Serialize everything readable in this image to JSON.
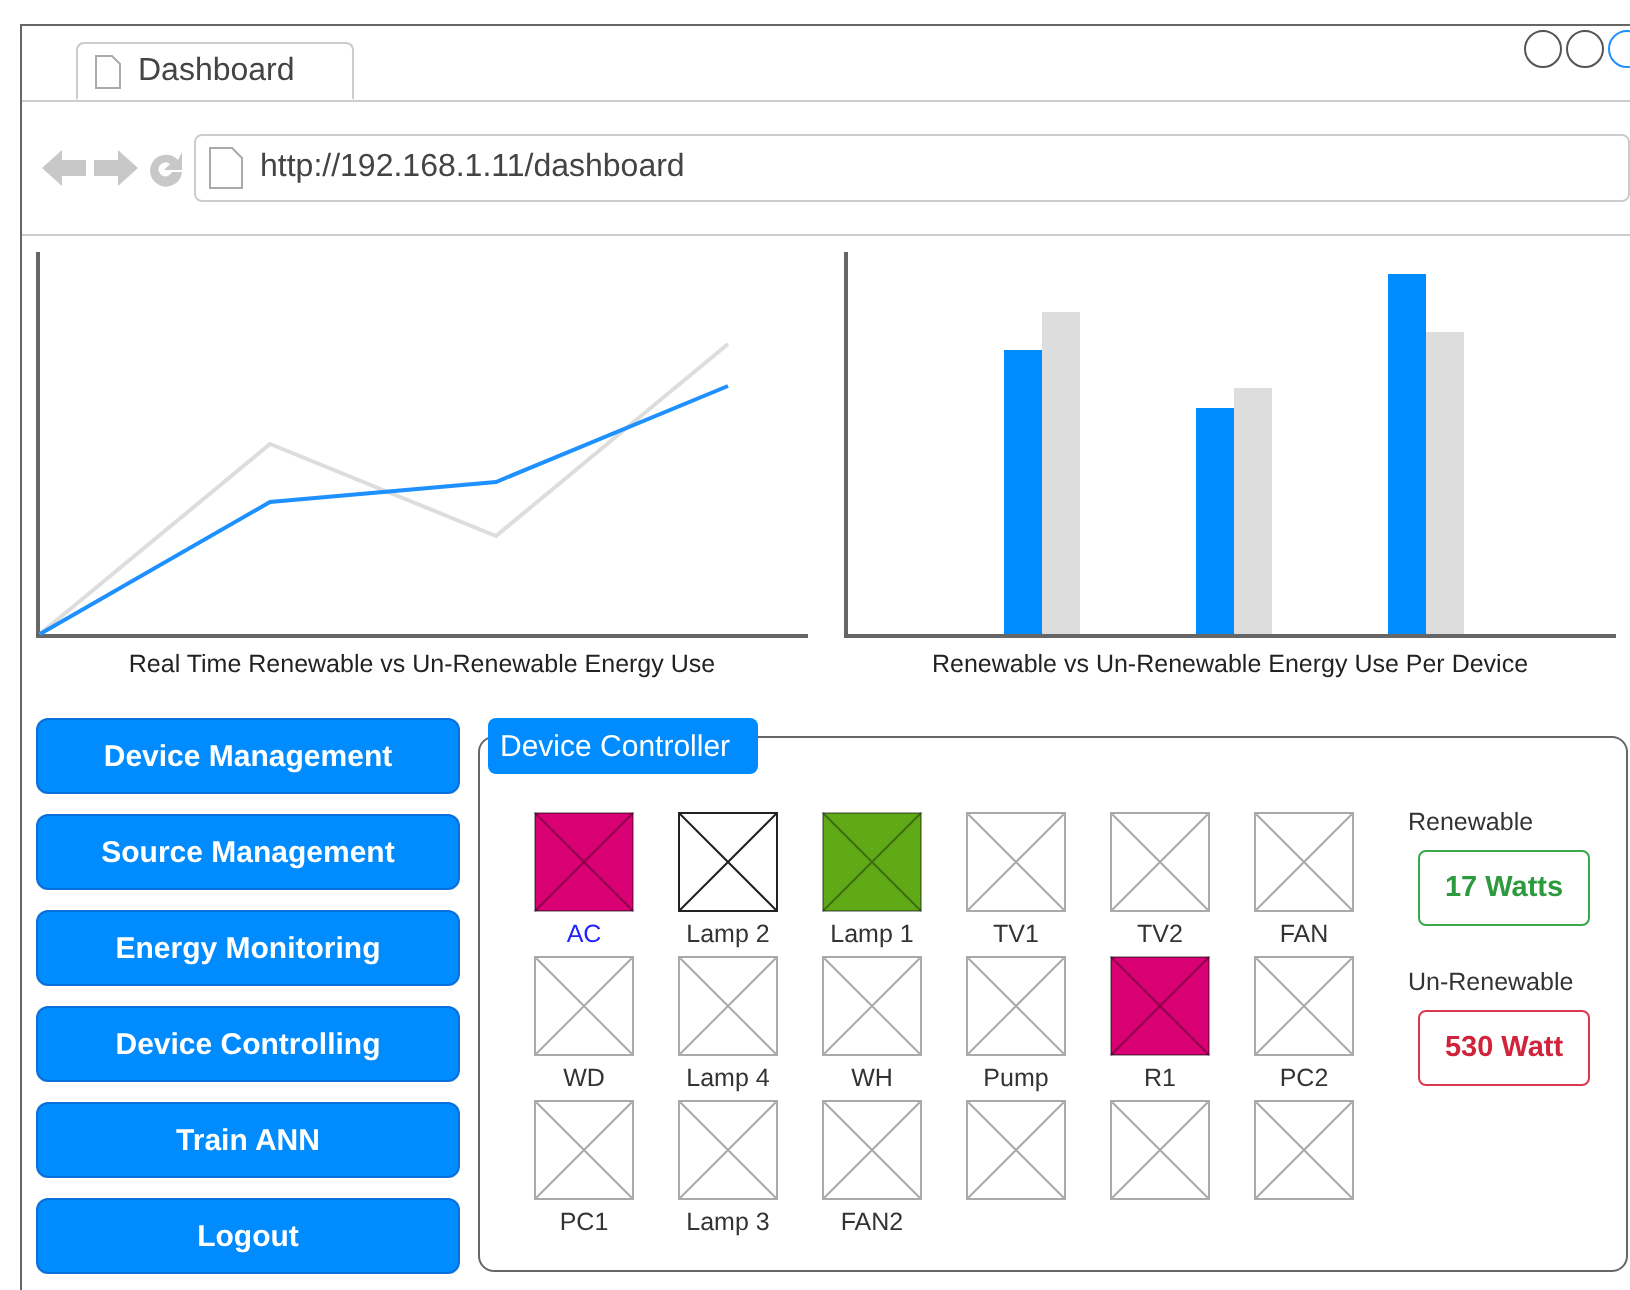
{
  "browser": {
    "tab": {
      "label": "Dashboard",
      "selected": true
    },
    "url": "http://192.168.1.11/dashboard"
  },
  "charts": [
    {
      "kind": "line",
      "caption": "Real Time Renewable vs Un-Renewable Energy Use"
    },
    {
      "kind": "bar",
      "caption": "Renewable vs Un-Renewable Energy Use Per Device"
    }
  ],
  "menu": [
    "Device Management",
    "Source Management",
    "Energy Monitoring",
    "Device Controlling",
    "Train ANN",
    "Logout"
  ],
  "controller": {
    "title": "Device Controller",
    "devices": [
      {
        "label": "AC",
        "color": "#d80073",
        "selected": false,
        "link": true
      },
      {
        "label": "Lamp 2",
        "color": "#ffffff",
        "selected": true,
        "link": false
      },
      {
        "label": "Lamp 1",
        "color": "#60a917",
        "selected": false,
        "link": false
      },
      {
        "label": "TV1",
        "color": "#ffffff",
        "selected": false,
        "link": false
      },
      {
        "label": "TV2",
        "color": "#ffffff",
        "selected": false,
        "link": false
      },
      {
        "label": "FAN",
        "color": "#ffffff",
        "selected": false,
        "link": false
      },
      {
        "label": "WD",
        "color": "#ffffff",
        "selected": false,
        "link": false
      },
      {
        "label": "Lamp 4",
        "color": "#ffffff",
        "selected": false,
        "link": false
      },
      {
        "label": "WH",
        "color": "#ffffff",
        "selected": false,
        "link": false
      },
      {
        "label": "Pump",
        "color": "#ffffff",
        "selected": false,
        "link": false
      },
      {
        "label": "R1",
        "color": "#d80073",
        "selected": false,
        "link": false
      },
      {
        "label": "PC2",
        "color": "#ffffff",
        "selected": false,
        "link": false
      },
      {
        "label": "PC1",
        "color": "#ffffff",
        "selected": false,
        "link": false
      },
      {
        "label": "Lamp 3",
        "color": "#ffffff",
        "selected": false,
        "link": false
      },
      {
        "label": "FAN2",
        "color": "#ffffff",
        "selected": false,
        "link": false
      },
      {
        "color": "#ffffff",
        "selected": false
      },
      {
        "color": "#ffffff",
        "selected": false
      },
      {
        "color": "#ffffff",
        "selected": false
      }
    ],
    "readings": [
      {
        "label": "Renewable",
        "value": "17 Watts",
        "kind": "good"
      },
      {
        "label": "Un-Renewable",
        "value": "530 Watt",
        "kind": "bad"
      }
    ]
  }
}
